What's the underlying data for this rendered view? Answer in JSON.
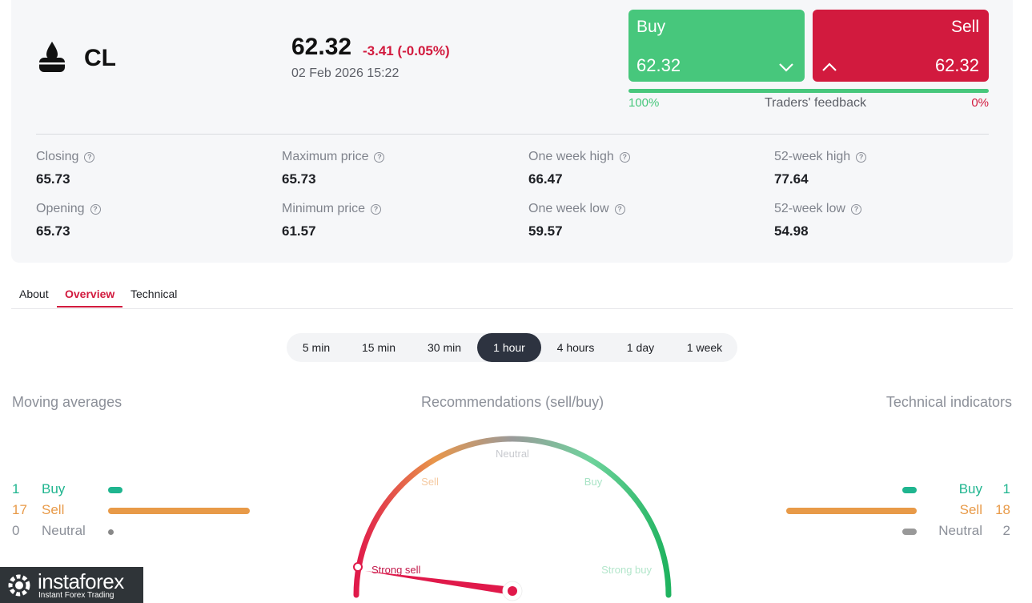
{
  "instrument": {
    "symbol": "CL",
    "icon": "oil-barrel-icon",
    "price": "62.32",
    "change": "-3.41 (-0.05%)",
    "datetime": "02 Feb 2026 15:22"
  },
  "trade": {
    "buy_label": "Buy",
    "buy_price": "62.32",
    "sell_label": "Sell",
    "sell_price": "62.32",
    "feedback_buy_pct": "100%",
    "feedback_label": "Traders' feedback",
    "feedback_sell_pct": "0%",
    "feedback_buy_fraction": 1.0
  },
  "stats": [
    {
      "label": "Closing",
      "value": "65.73"
    },
    {
      "label": "Maximum price",
      "value": "65.73"
    },
    {
      "label": "One week high",
      "value": "66.47"
    },
    {
      "label": "52-week high",
      "value": "77.64"
    },
    {
      "label": "Opening",
      "value": "65.73"
    },
    {
      "label": "Minimum price",
      "value": "61.57"
    },
    {
      "label": "One week low",
      "value": "59.57"
    },
    {
      "label": "52-week low",
      "value": "54.98"
    }
  ],
  "tabs": [
    "About",
    "Overview",
    "Technical"
  ],
  "active_tab": "Overview",
  "periods": [
    "5 min",
    "15 min",
    "30 min",
    "1 hour",
    "4 hours",
    "1 day",
    "1 week"
  ],
  "active_period": "1 hour",
  "moving_averages": {
    "title": "Moving averages",
    "rows": [
      {
        "count": "1",
        "label": "Buy",
        "value": 1,
        "color": "#1fb58f"
      },
      {
        "count": "17",
        "label": "Sell",
        "value": 17,
        "color": "#e89a48"
      },
      {
        "count": "0",
        "label": "Neutral",
        "value": 0,
        "color": "#888888"
      }
    ]
  },
  "recommendations": {
    "title": "Recommendations (sell/buy)",
    "labels": {
      "strong_sell": "Strong sell",
      "sell": "Sell",
      "neutral": "Neutral",
      "buy": "Buy",
      "strong_buy": "Strong buy"
    },
    "current": "Strong sell"
  },
  "technical_indicators": {
    "title": "Technical indicators",
    "rows": [
      {
        "count": "1",
        "label": "Buy",
        "value": 1,
        "color": "#1fb58f"
      },
      {
        "count": "18",
        "label": "Sell",
        "value": 18,
        "color": "#e89a48"
      },
      {
        "count": "2",
        "label": "Neutral",
        "value": 2,
        "color": "#999999"
      }
    ]
  },
  "colors": {
    "buy": "#47c77c",
    "sell": "#d21a3e",
    "dark": "#2d3340"
  },
  "logo": {
    "name": "instaforex",
    "tagline": "Instant Forex Trading"
  }
}
